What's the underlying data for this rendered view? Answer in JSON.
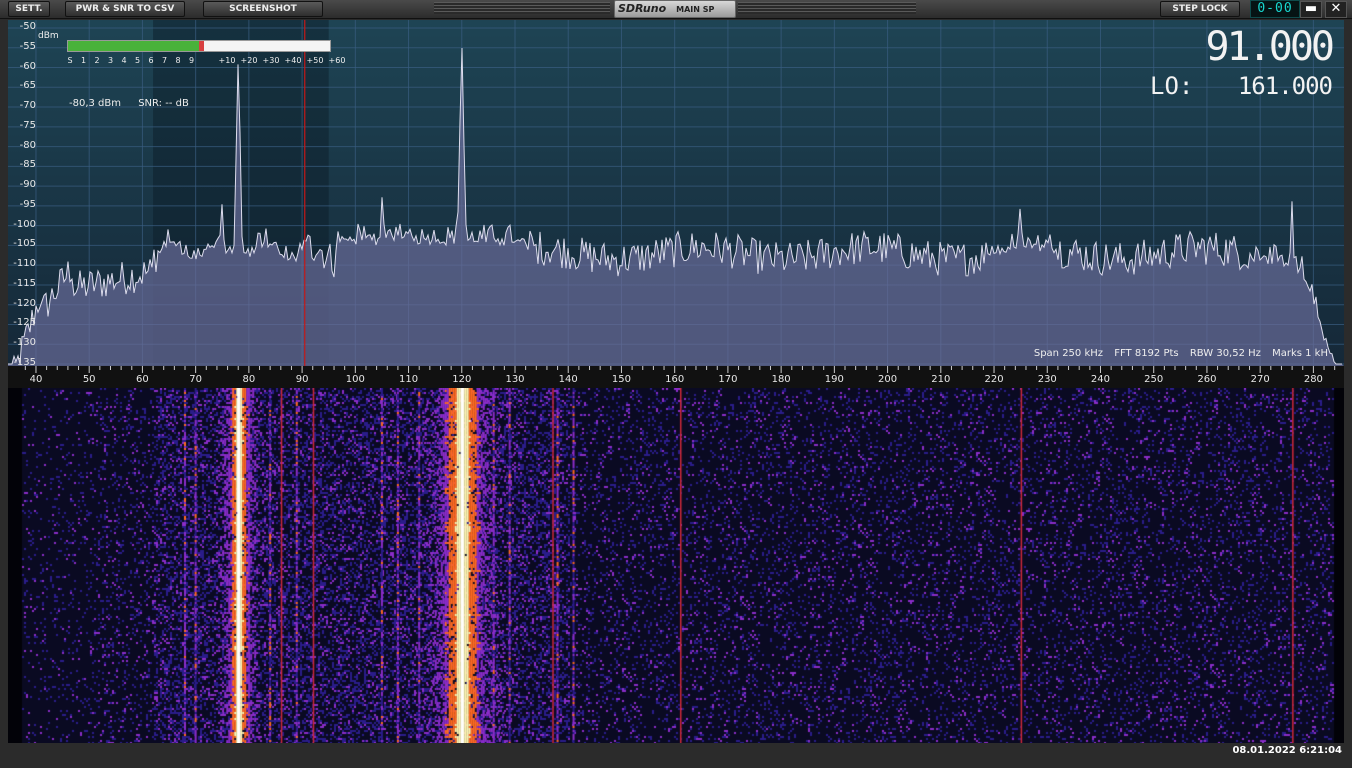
{
  "toolbar": {
    "settings": "SETT.",
    "pwr_snr": "PWR & SNR TO CSV",
    "screenshot": "SCREENSHOT",
    "brand": "SDRuno",
    "mode": "MAIN SP",
    "step_lock": "STEP LOCK",
    "lcd": "0-00",
    "minimize": "▬",
    "close": "✕"
  },
  "spectrum": {
    "unit": "dBm",
    "db_ticks": [
      "-50",
      "-55",
      "-60",
      "-65",
      "-70",
      "-75",
      "-80",
      "-85",
      "-90",
      "-95",
      "-100",
      "-105",
      "-110",
      "-115",
      "-120",
      "-125",
      "-130",
      "-135"
    ],
    "freq_ticks": [
      "40",
      "50",
      "60",
      "70",
      "80",
      "90",
      "100",
      "110",
      "120",
      "130",
      "140",
      "150",
      "160",
      "170",
      "180",
      "190",
      "200",
      "210",
      "220",
      "230",
      "240",
      "250",
      "260",
      "270",
      "280"
    ],
    "s_scale": [
      "S",
      "1",
      "2",
      "3",
      "4",
      "5",
      "6",
      "7",
      "8",
      "9",
      "+10",
      "+20",
      "+30",
      "+40",
      "+50",
      "+60"
    ],
    "level": "-80,3 dBm",
    "snr": "SNR: -- dB",
    "frequency": "91.000",
    "lo_label": "LO:",
    "lo_value": "161.000",
    "span": "Span 250 kHz",
    "fft": "FFT 8192 Pts",
    "rbw": "RBW 30,52 Hz",
    "marks": "Marks 1 kH",
    "tuned_khz": 90.5,
    "smeter_fraction": 0.5,
    "x_range": [
      37,
      285
    ],
    "y_range": [
      -50,
      -135
    ],
    "peaks": [
      {
        "khz": 78,
        "dbm": -59
      },
      {
        "khz": 120,
        "dbm": -55
      },
      {
        "khz": 225,
        "dbm": -92
      },
      {
        "khz": 276,
        "dbm": -94
      },
      {
        "khz": 105,
        "dbm": -92
      },
      {
        "khz": 75,
        "dbm": -95
      }
    ],
    "colors": {
      "trace": "#dcdcec",
      "fill": "#6a6c9a",
      "grid": "#3a5e82",
      "marker": "#c41818"
    }
  },
  "waterfall": {
    "strong_lines_khz": [
      78,
      120
    ],
    "medium_lines_khz": [
      68,
      70,
      77,
      80,
      84,
      89,
      105,
      108,
      112,
      117,
      123,
      126,
      129,
      138,
      141
    ],
    "thin_red_khz": [
      86,
      92,
      137,
      161,
      225,
      276
    ],
    "colors": {
      "base": "#0a0a22",
      "weak": "#2a1c8a",
      "mid": "#8a2cc8",
      "hot": "#ff6a20",
      "max": "#fff6b0"
    }
  },
  "status": {
    "datetime": "08.01.2022 6:21:04"
  }
}
